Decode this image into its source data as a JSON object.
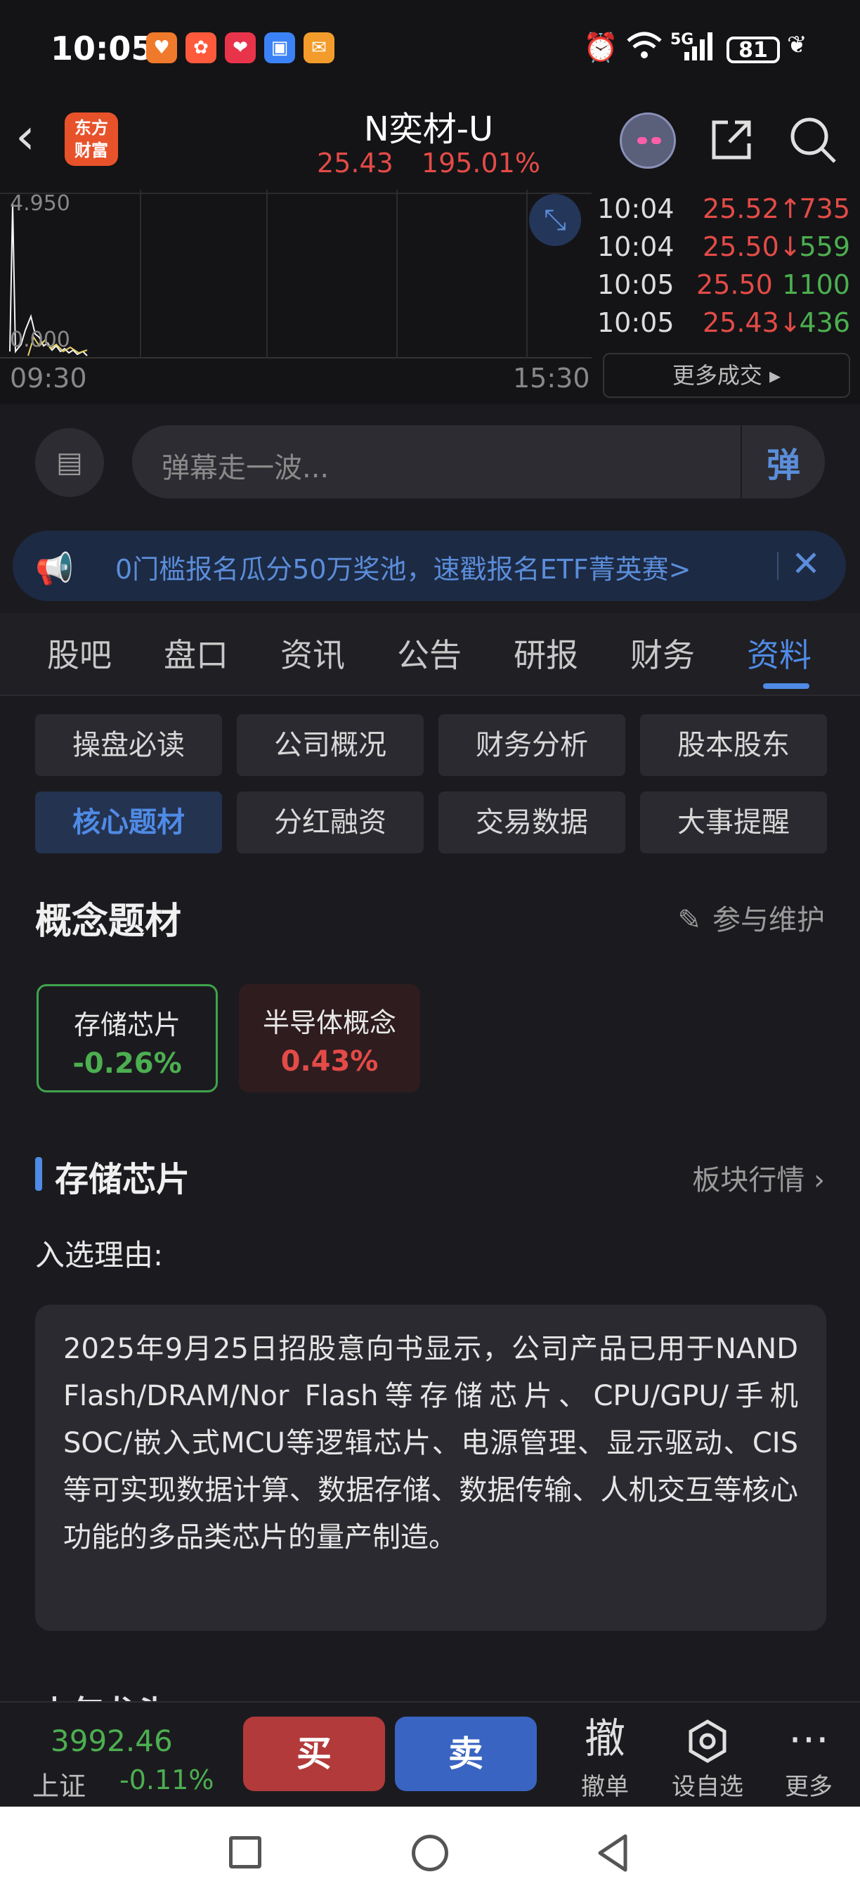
{
  "status_bar": {
    "time": "10:05",
    "network": "5G",
    "battery": "81",
    "notif_colors": [
      "#f07a2b",
      "#ff5a3c",
      "#e8344a",
      "#3b82f6",
      "#f39c2b"
    ]
  },
  "header": {
    "title": "N奕材-U",
    "price": "25.43",
    "change_pct": "195.01%",
    "logo_line1": "东方",
    "logo_line2": "财富"
  },
  "chart": {
    "y_top_label": "4.950",
    "y_bottom_label": "0.000",
    "x_start": "09:30",
    "x_end": "15:30"
  },
  "trades": {
    "rows": [
      {
        "time": "10:04",
        "price": "25.52↑",
        "vol": "735",
        "vol_color": "#e34b47"
      },
      {
        "time": "10:04",
        "price": "25.50↓",
        "vol": "559",
        "vol_color": "#4caf50"
      },
      {
        "time": "10:05",
        "price": "25.50",
        "vol": "1100",
        "vol_color": "#4caf50"
      },
      {
        "time": "10:05",
        "price": "25.43↓",
        "vol": "436",
        "vol_color": "#4caf50"
      }
    ],
    "more_label": "更多成交 ▸"
  },
  "danmu": {
    "placeholder": "弹幕走一波...",
    "button": "弹"
  },
  "banner": {
    "text": "0门槛报名瓜分50万奖池，速戳报名ETF菁英赛>"
  },
  "tabs": [
    "股吧",
    "盘口",
    "资讯",
    "公告",
    "研报",
    "财务",
    "资料"
  ],
  "subtabs": [
    "操盘必读",
    "公司概况",
    "财务分析",
    "股本股东",
    "核心题材",
    "分红融资",
    "交易数据",
    "大事提醒"
  ],
  "concepts": {
    "title": "概念题材",
    "maintain": "参与维护",
    "chips": [
      {
        "name": "存储芯片",
        "value": "-0.26%"
      },
      {
        "name": "半导体概念",
        "value": "0.43%"
      }
    ]
  },
  "detail": {
    "concept_name": "存储芯片",
    "board_link": "板块行情 ›",
    "reason_label": "入选理由:",
    "reason_text": "2025年9月25日招股意向书显示，公司产品已用于NAND Flash/DRAM/Nor Flash等存储芯片、CPU/GPU/手机SOC/嵌入式MCU等逻辑芯片、电源管理、显示驱动、CIS等可实现数据计算、数据存储、数据传输、人机交互等核心功能的多品类芯片的量产制造。",
    "next_section_partial": "上年龙头"
  },
  "trade_bar": {
    "index_value": "3992.46",
    "index_name": "上证",
    "index_change": "-0.11%",
    "buy": "买",
    "sell": "卖",
    "cancel_icon": "撤",
    "cancel_label": "撤单",
    "watch_label": "设自选",
    "more_label": "更多"
  }
}
